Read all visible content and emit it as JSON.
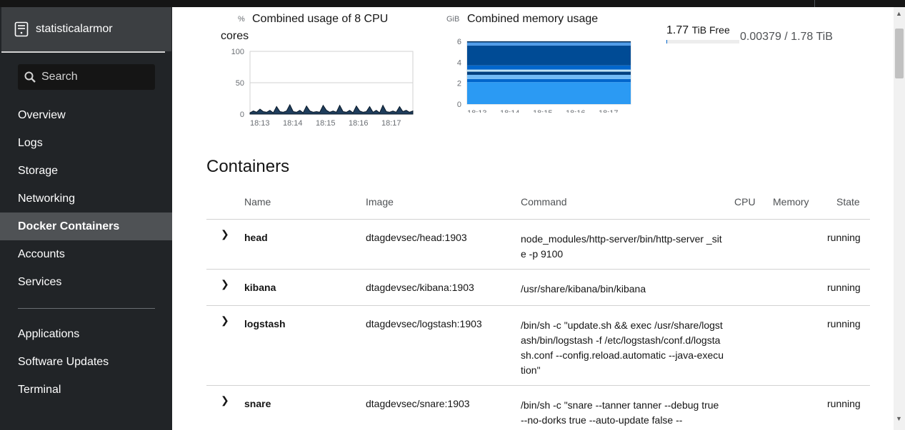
{
  "host": {
    "name": "statisticalarmor"
  },
  "search": {
    "label": "Search"
  },
  "nav": [
    {
      "label": "Overview"
    },
    {
      "label": "Logs"
    },
    {
      "label": "Storage"
    },
    {
      "label": "Networking"
    },
    {
      "label": "Docker Containers",
      "active": true
    },
    {
      "label": "Accounts"
    },
    {
      "label": "Services"
    },
    {
      "label": "Applications"
    },
    {
      "label": "Software Updates"
    },
    {
      "label": "Terminal"
    }
  ],
  "cpu": {
    "unit": "%",
    "title_line1": "Combined usage of 8 CPU",
    "title_line2": "cores"
  },
  "memory": {
    "unit": "GiB",
    "title": "Combined memory usage"
  },
  "storage": {
    "free_value": "1.77",
    "free_label": "TiB Free",
    "used_text": "0.00379 / 1.78 TiB",
    "used_fraction": 0.00213
  },
  "chart_data": [
    {
      "type": "area",
      "ylabel": "%",
      "ylim": [
        0,
        100
      ],
      "yticks": [
        "0",
        "50",
        "100"
      ],
      "categories": [
        "18:13",
        "18:14",
        "18:15",
        "18:16",
        "18:17"
      ],
      "grid": true,
      "series_values": [
        2,
        5,
        3,
        8,
        4,
        3,
        6,
        2,
        12,
        4,
        3,
        5,
        15,
        4,
        3,
        6,
        2,
        13,
        5,
        3,
        4,
        3,
        14,
        6,
        3,
        5,
        3,
        14,
        4,
        3,
        6,
        2,
        13,
        5,
        3,
        4,
        12,
        3,
        6,
        2,
        14,
        4,
        3,
        5,
        3,
        12,
        4,
        6,
        3,
        5
      ]
    },
    {
      "type": "area",
      "ylabel": "GiB",
      "ylim": [
        0,
        6
      ],
      "yticks": [
        "0",
        "2",
        "4",
        "6"
      ],
      "categories": [
        "18:13",
        "18:14",
        "18:15",
        "18:16",
        "18:17"
      ],
      "grid": true,
      "stacked_bands": [
        {
          "from": 0,
          "to": 2.1,
          "color": "#2b9af3"
        },
        {
          "from": 2.1,
          "to": 2.4,
          "color": "#0066cc"
        },
        {
          "from": 2.4,
          "to": 2.8,
          "color": "#73bcf7"
        },
        {
          "from": 2.8,
          "to": 3.1,
          "color": "#004080"
        },
        {
          "from": 3.1,
          "to": 3.3,
          "color": "#bee1f4"
        },
        {
          "from": 3.3,
          "to": 3.7,
          "color": "#06c"
        },
        {
          "from": 3.7,
          "to": 5.6,
          "color": "#004b95"
        },
        {
          "from": 5.6,
          "to": 5.9,
          "color": "#519de9"
        },
        {
          "from": 5.9,
          "to": 6.0,
          "color": "#002f5d"
        }
      ]
    }
  ],
  "containers": {
    "title": "Containers",
    "headers": {
      "name": "Name",
      "image": "Image",
      "command": "Command",
      "cpu": "CPU",
      "memory": "Memory",
      "state": "State"
    },
    "rows": [
      {
        "name": "head",
        "image": "dtagdevsec/head:1903",
        "command": "node_modules/http-server/bin/http-server _site -p 9100",
        "state": "running"
      },
      {
        "name": "kibana",
        "image": "dtagdevsec/kibana:1903",
        "command": "/usr/share/kibana/bin/kibana",
        "state": "running"
      },
      {
        "name": "logstash",
        "image": "dtagdevsec/logstash:1903",
        "command": "/bin/sh -c \"update.sh && exec /usr/share/logstash/bin/logstash -f /etc/logstash/conf.d/logstash.conf --config.reload.automatic --java-execution\"",
        "state": "running"
      },
      {
        "name": "snare",
        "image": "dtagdevsec/snare:1903",
        "command": "/bin/sh -c \"snare --tanner tanner --debug true --no-dorks true --auto-update false --",
        "state": "running"
      }
    ]
  }
}
